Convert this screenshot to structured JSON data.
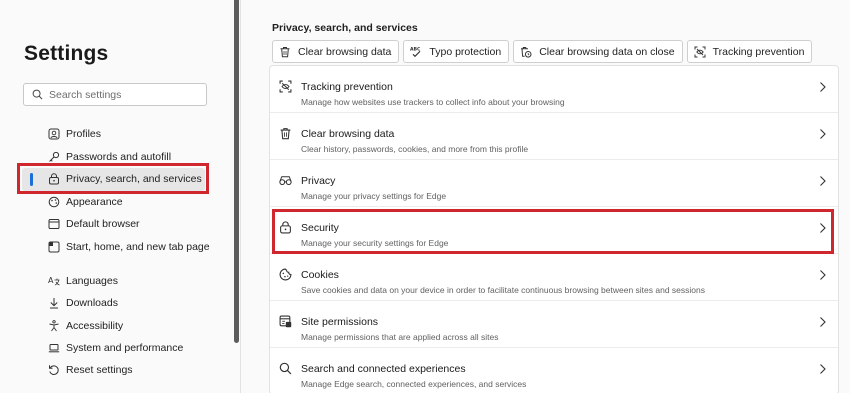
{
  "sidebar": {
    "title": "Settings",
    "search_placeholder": "Search settings",
    "items": [
      {
        "label": "Profiles",
        "icon": "profiles-icon"
      },
      {
        "label": "Passwords and autofill",
        "icon": "key-icon"
      },
      {
        "label": "Privacy, search, and services",
        "icon": "lock-icon",
        "active": true
      },
      {
        "label": "Appearance",
        "icon": "appearance-icon"
      },
      {
        "label": "Default browser",
        "icon": "browser-icon"
      },
      {
        "label": "Start, home, and new tab page",
        "icon": "home-tab-icon"
      },
      {
        "label": "Languages",
        "icon": "languages-icon"
      },
      {
        "label": "Downloads",
        "icon": "download-icon"
      },
      {
        "label": "Accessibility",
        "icon": "accessibility-icon"
      },
      {
        "label": "System and performance",
        "icon": "laptop-icon"
      },
      {
        "label": "Reset settings",
        "icon": "reset-icon"
      }
    ]
  },
  "main": {
    "section_title": "Privacy, search, and services",
    "quick_actions": [
      {
        "label": "Clear browsing data",
        "icon": "trash-icon"
      },
      {
        "label": "Typo protection",
        "icon": "abc-check-icon"
      },
      {
        "label": "Clear browsing data on close",
        "icon": "trash-clock-icon"
      },
      {
        "label": "Tracking prevention",
        "icon": "tracking-icon"
      }
    ],
    "rows": [
      {
        "title": "Tracking prevention",
        "desc": "Manage how websites use trackers to collect info about your browsing",
        "icon": "tracking-icon"
      },
      {
        "title": "Clear browsing data",
        "desc": "Clear history, passwords, cookies, and more from this profile",
        "icon": "trash-icon"
      },
      {
        "title": "Privacy",
        "desc": "Manage your privacy settings for Edge",
        "icon": "glasses-icon"
      },
      {
        "title": "Security",
        "desc": "Manage your security settings for Edge",
        "icon": "lock-icon"
      },
      {
        "title": "Cookies",
        "desc": "Save cookies and data on your device in order to facilitate continuous browsing between sites and sessions",
        "icon": "cookie-icon"
      },
      {
        "title": "Site permissions",
        "desc": "Manage permissions that are applied across all sites",
        "icon": "permissions-icon"
      },
      {
        "title": "Search and connected experiences",
        "desc": "Manage Edge search, connected experiences, and services",
        "icon": "search-icon"
      }
    ]
  },
  "colors": {
    "accent": "#1d6fd8",
    "highlight": "#d0262e"
  }
}
